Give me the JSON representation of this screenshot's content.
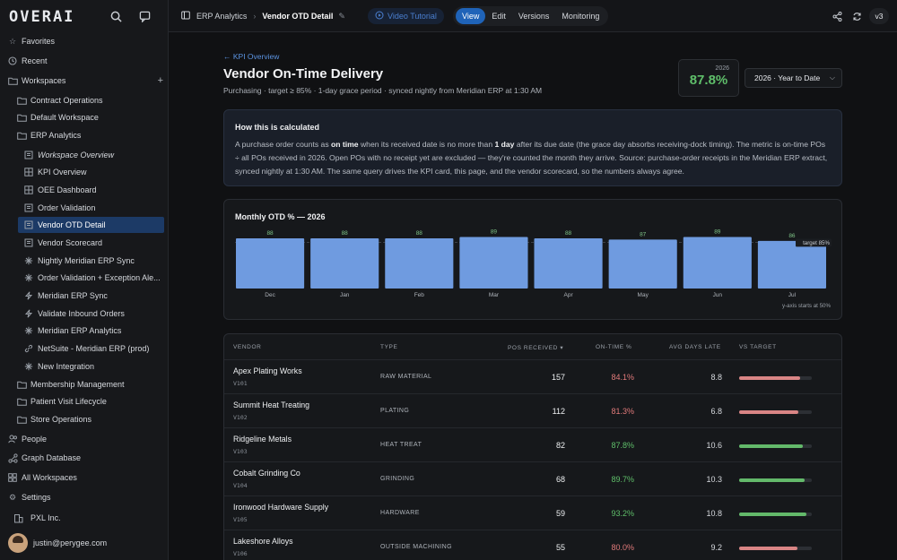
{
  "app": {
    "logo": "OVERAI"
  },
  "sidebar": {
    "favorites": "Favorites",
    "recent": "Recent",
    "workspaces": "Workspaces",
    "items": [
      {
        "label": "Contract Operations",
        "icon": "folder-icon"
      },
      {
        "label": "Default Workspace",
        "icon": "folder-icon"
      },
      {
        "label": "ERP Analytics",
        "icon": "folder-icon"
      },
      {
        "label": "Workspace Overview",
        "icon": "page-icon"
      },
      {
        "label": "KPI Overview",
        "icon": "grid-icon"
      },
      {
        "label": "OEE Dashboard",
        "icon": "grid-icon"
      },
      {
        "label": "Order Validation",
        "icon": "page-icon"
      },
      {
        "label": "Vendor OTD Detail",
        "icon": "page-icon"
      },
      {
        "label": "Vendor Scorecard",
        "icon": "page-icon"
      },
      {
        "label": "Nightly Meridian ERP Sync",
        "icon": "workflow-icon"
      },
      {
        "label": "Order Validation + Exception Ale...",
        "icon": "workflow-icon"
      },
      {
        "label": "Meridian ERP Sync",
        "icon": "bolt-icon"
      },
      {
        "label": "Validate Inbound Orders",
        "icon": "bolt-icon"
      },
      {
        "label": "Meridian ERP Analytics",
        "icon": "workflow-icon"
      },
      {
        "label": "NetSuite - Meridian ERP (prod)",
        "icon": "link-icon"
      },
      {
        "label": "New Integration",
        "icon": "workflow-icon"
      },
      {
        "label": "Membership Management",
        "icon": "folder-icon"
      },
      {
        "label": "Patient Visit Lifecycle",
        "icon": "folder-icon"
      },
      {
        "label": "Store Operations",
        "icon": "folder-icon"
      }
    ],
    "people": "People",
    "graph_database": "Graph Database",
    "all_workspaces": "All Workspaces",
    "settings": "Settings",
    "org": "PXL Inc.",
    "user_email": "justin@perygee.com"
  },
  "topbar": {
    "breadcrumb_parent": "ERP Analytics",
    "breadcrumb_current": "Vendor OTD Detail",
    "video_tutorial": "Video Tutorial",
    "tabs": [
      "View",
      "Edit",
      "Versions",
      "Monitoring"
    ],
    "version": "v3"
  },
  "page": {
    "back_link": "← KPI Overview",
    "title": "Vendor On-Time Delivery",
    "subtitle": "Purchasing · target ≥ 85% · 1-day grace period · synced nightly from Meridian ERP at 1:30 AM",
    "kpi_year": "2026",
    "kpi_value": "87.8%",
    "period_select": "2026 · Year to Date"
  },
  "howto": {
    "heading": "How this is calculated",
    "p1": "A purchase order counts as ",
    "b1": "on time",
    "p2": " when its received date is no more than ",
    "b2": "1 day",
    "p3": " after its due date (the grace day absorbs receiving-dock timing). The metric is on-time POs ÷ all POs received in 2026. Open POs with no receipt yet are excluded — they're counted the month they arrive. Source: purchase-order receipts in the Meridian ERP extract, synced nightly at 1:30 AM. The same query drives the KPI card, this page, and the vendor scorecard, so the numbers always agree."
  },
  "chart_data": {
    "type": "bar",
    "title": "Monthly OTD % — 2026",
    "categories": [
      "Dec",
      "Jan",
      "Feb",
      "Mar",
      "Apr",
      "May",
      "Jun",
      "Jul"
    ],
    "values": [
      88,
      88,
      88,
      89,
      88,
      87,
      89,
      86
    ],
    "ylim": [
      50,
      90
    ],
    "target": 85,
    "target_label": "target 85%",
    "note": "y-axis starts at 50%",
    "bar_color": "#6f9be0"
  },
  "table": {
    "headers": [
      "VENDOR",
      "TYPE",
      "POS RECEIVED ▾",
      "ON-TIME %",
      "AVG DAYS LATE",
      "VS TARGET"
    ],
    "rows": [
      {
        "vendor": "Apex Plating Works",
        "id": "V101",
        "type": "RAW MATERIAL",
        "pos": "157",
        "ontime": "84.1%",
        "late": "8.8",
        "pct": 84.1,
        "status": "below"
      },
      {
        "vendor": "Summit Heat Treating",
        "id": "V102",
        "type": "PLATING",
        "pos": "112",
        "ontime": "81.3%",
        "late": "6.8",
        "pct": 81.3,
        "status": "below"
      },
      {
        "vendor": "Ridgeline Metals",
        "id": "V103",
        "type": "HEAT TREAT",
        "pos": "82",
        "ontime": "87.8%",
        "late": "10.6",
        "pct": 87.8,
        "status": "above"
      },
      {
        "vendor": "Cobalt Grinding Co",
        "id": "V104",
        "type": "GRINDING",
        "pos": "68",
        "ontime": "89.7%",
        "late": "10.3",
        "pct": 89.7,
        "status": "above"
      },
      {
        "vendor": "Ironwood Hardware Supply",
        "id": "V105",
        "type": "HARDWARE",
        "pos": "59",
        "ontime": "93.2%",
        "late": "10.8",
        "pct": 93.2,
        "status": "above"
      },
      {
        "vendor": "Lakeshore Alloys",
        "id": "V106",
        "type": "OUTSIDE MACHINING",
        "pos": "55",
        "ontime": "80.0%",
        "late": "9.2",
        "pct": 80.0,
        "status": "below"
      }
    ]
  },
  "colors": {
    "accent": "#1f63b8",
    "good": "#5fbf6a",
    "bad": "#e07a7a",
    "bar_good": "#63b96a",
    "bar_bad": "#d98585"
  }
}
